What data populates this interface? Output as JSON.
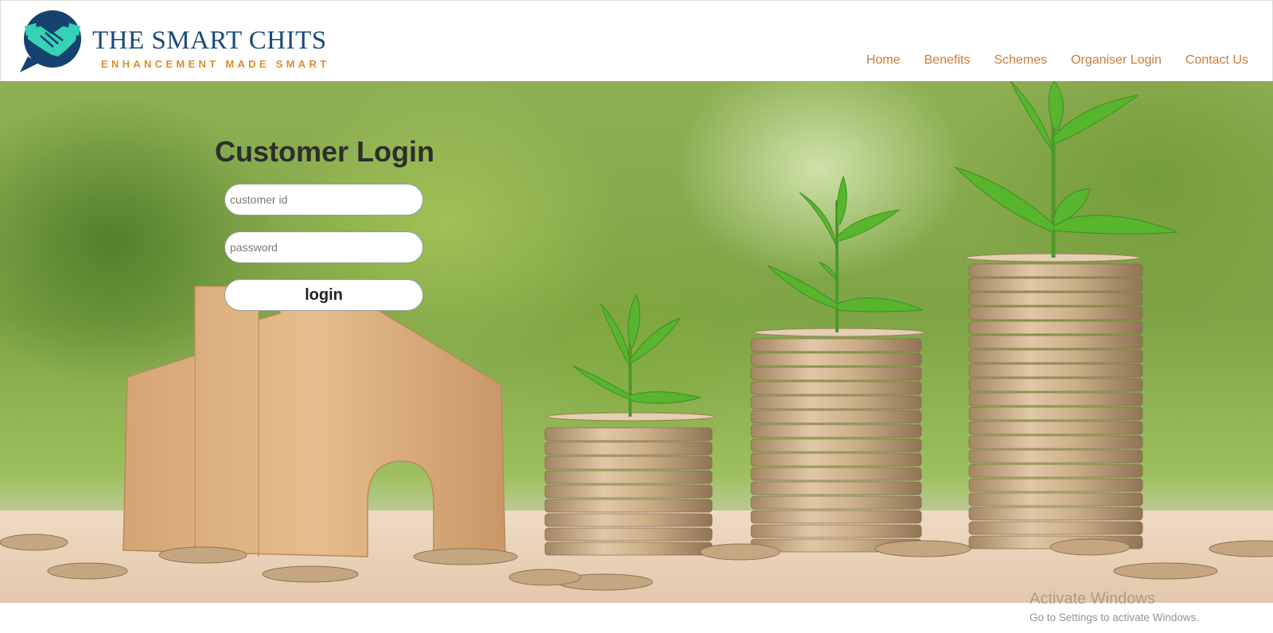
{
  "brand": {
    "name": "THE SMART CHITS",
    "tagline": "ENHANCEMENT MADE SMART",
    "colors": {
      "navy": "#1b4a7a",
      "teal": "#37d2b6",
      "orange": "#e08a2c"
    }
  },
  "nav": {
    "items": [
      {
        "label": "Home"
      },
      {
        "label": "Benefits"
      },
      {
        "label": "Schemes"
      },
      {
        "label": "Organiser Login"
      },
      {
        "label": "Contact Us"
      }
    ],
    "color": "#c87b3c"
  },
  "login": {
    "title": "Customer Login",
    "customer_id_placeholder": "customer id",
    "password_placeholder": "password",
    "button_label": "login"
  },
  "watermark": {
    "title": "Activate Windows",
    "subtitle": "Go to Settings to activate Windows."
  }
}
